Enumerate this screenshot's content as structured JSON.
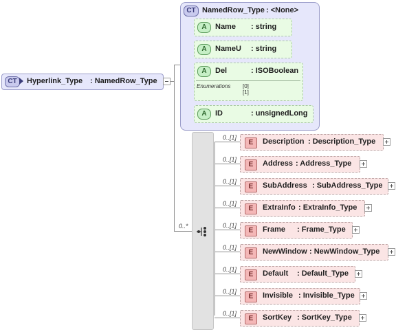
{
  "root": {
    "badge": "CT",
    "name": "Hyperlink_Type",
    "type": ": NamedRow_Type"
  },
  "complex": {
    "badge": "CT",
    "name": "NamedRow_Type",
    "type": ": <None>"
  },
  "attributes": [
    {
      "badge": "A",
      "name": "Name",
      "type": ": string"
    },
    {
      "badge": "A",
      "name": "NameU",
      "type": ": string"
    },
    {
      "badge": "A",
      "name": "Del",
      "type": ": ISOBoolean",
      "enum_title": "Enumerations",
      "enum_values": [
        "[0]",
        "[1]"
      ]
    },
    {
      "badge": "A",
      "name": "ID",
      "type": ": unsignedLong"
    }
  ],
  "sequence_cardinality": "0..*",
  "elements": [
    {
      "badge": "E",
      "card": "0..[1]",
      "name": "Description",
      "type": ": Description_Type"
    },
    {
      "badge": "E",
      "card": "0..[1]",
      "name": "Address",
      "type": ": Address_Type"
    },
    {
      "badge": "E",
      "card": "0..[1]",
      "name": "SubAddress",
      "type": ": SubAddress_Type"
    },
    {
      "badge": "E",
      "card": "0..[1]",
      "name": "ExtraInfo",
      "type": ": ExtraInfo_Type"
    },
    {
      "badge": "E",
      "card": "0..[1]",
      "name": "Frame",
      "type": ": Frame_Type"
    },
    {
      "badge": "E",
      "card": "0..[1]",
      "name": "NewWindow",
      "type": ": NewWindow_Type"
    },
    {
      "badge": "E",
      "card": "0..[1]",
      "name": "Default",
      "type": ": Default_Type"
    },
    {
      "badge": "E",
      "card": "0..[1]",
      "name": "Invisible",
      "type": ": Invisible_Type"
    },
    {
      "badge": "E",
      "card": "0..[1]",
      "name": "SortKey",
      "type": ": SortKey_Type"
    }
  ],
  "colors": {
    "complex_fill": "#e6e7fb",
    "attribute_fill": "#e9fbe4",
    "element_fill": "#fbe5e5",
    "sequence_fill": "#e2e2e2"
  }
}
